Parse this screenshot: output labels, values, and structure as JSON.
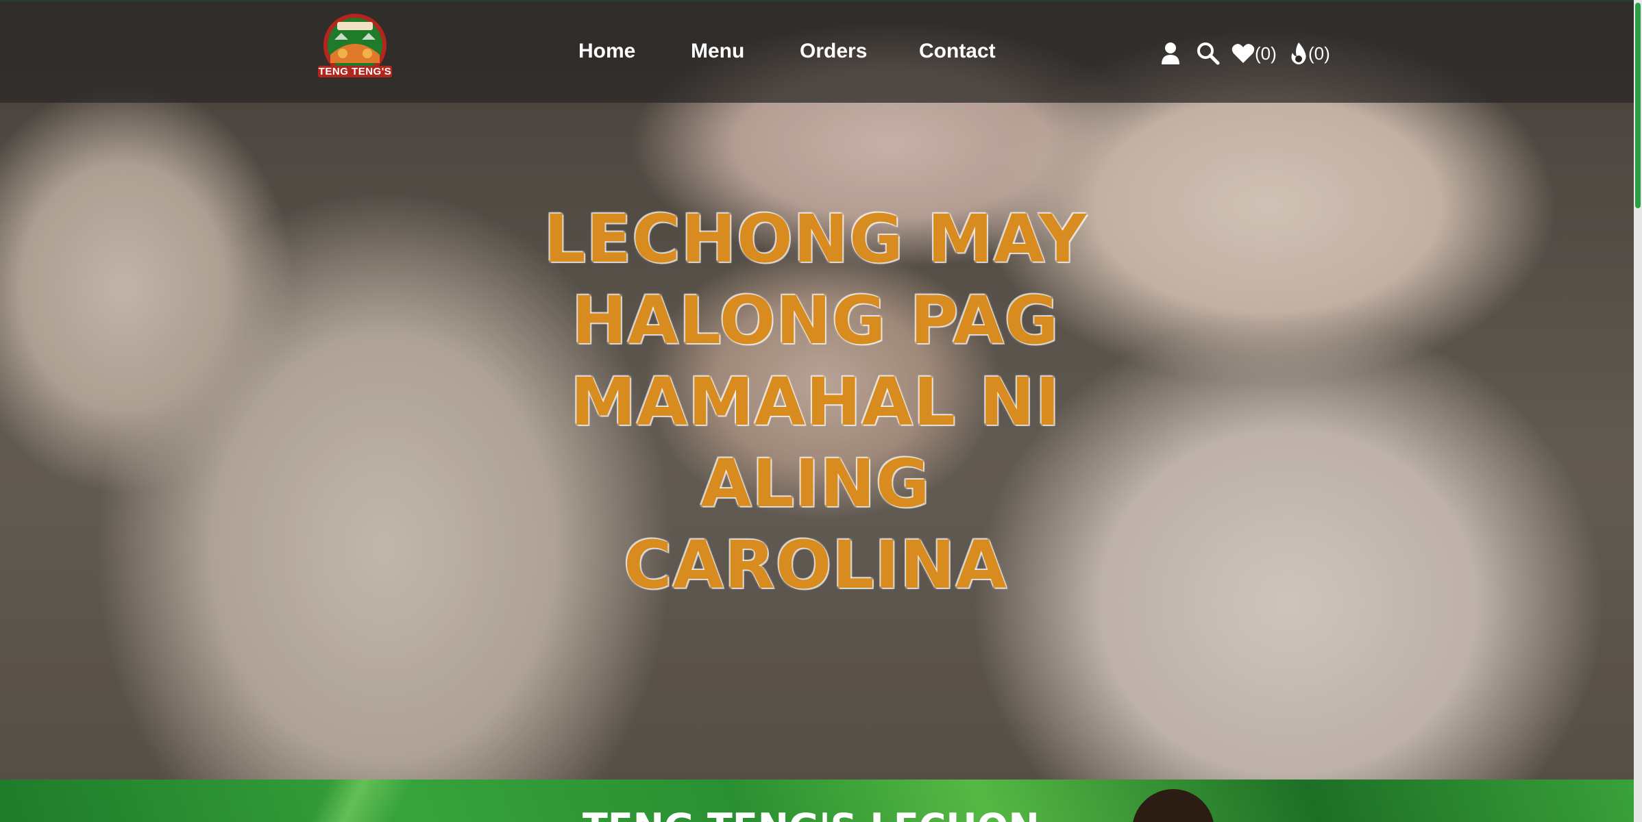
{
  "brand": {
    "logo_text": "TENG TENG'S"
  },
  "nav": {
    "items": [
      {
        "label": "Home"
      },
      {
        "label": "Menu"
      },
      {
        "label": "Orders"
      },
      {
        "label": "Contact"
      }
    ]
  },
  "header_icons": {
    "user": "user-icon",
    "search": "search-icon",
    "wishlist": {
      "icon": "heart-icon",
      "count": "(0)"
    },
    "cart": {
      "icon": "flame-icon",
      "count": "(0)"
    }
  },
  "hero": {
    "lines": [
      "LECHONG MAY",
      "HALONG PAG",
      "MAMAHAL NI ALING",
      "CAROLINA"
    ],
    "text_color": "#d88b1f"
  },
  "next_section": {
    "title": "TENG TENG'S LECHON"
  },
  "colors": {
    "accent_green": "#2e9e46",
    "logo_red": "#b3261e"
  }
}
